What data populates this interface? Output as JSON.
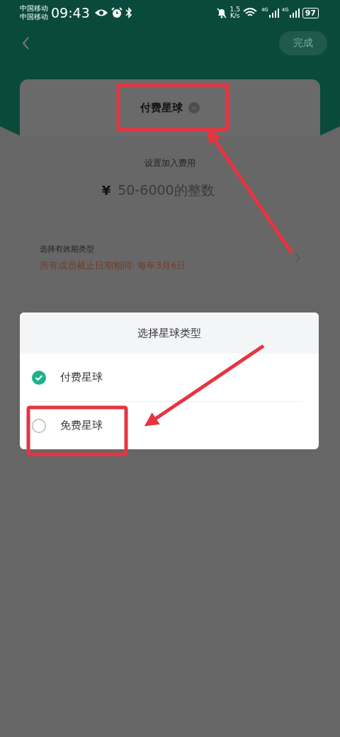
{
  "status_bar": {
    "carriers": [
      "中国移动",
      "中国移动"
    ],
    "time": "09:43",
    "speed": [
      "1.5",
      "K/s"
    ],
    "network_labels": [
      "4G",
      "4G"
    ],
    "battery": "97"
  },
  "nav": {
    "done_button": {
      "label": "完成",
      "disabled": true
    }
  },
  "card": {
    "title": "付费星球",
    "fee_label": "设置加入费用",
    "currency": "¥",
    "fee_placeholder": "50-6000的整数",
    "validity_label": "选择有效期类型",
    "validity_value": "所有成员截止日期相同: 每年3月6日"
  },
  "dialog": {
    "title": "选择星球类型",
    "options": [
      {
        "label": "付费星球",
        "selected": true
      },
      {
        "label": "免费星球",
        "selected": false
      }
    ]
  }
}
